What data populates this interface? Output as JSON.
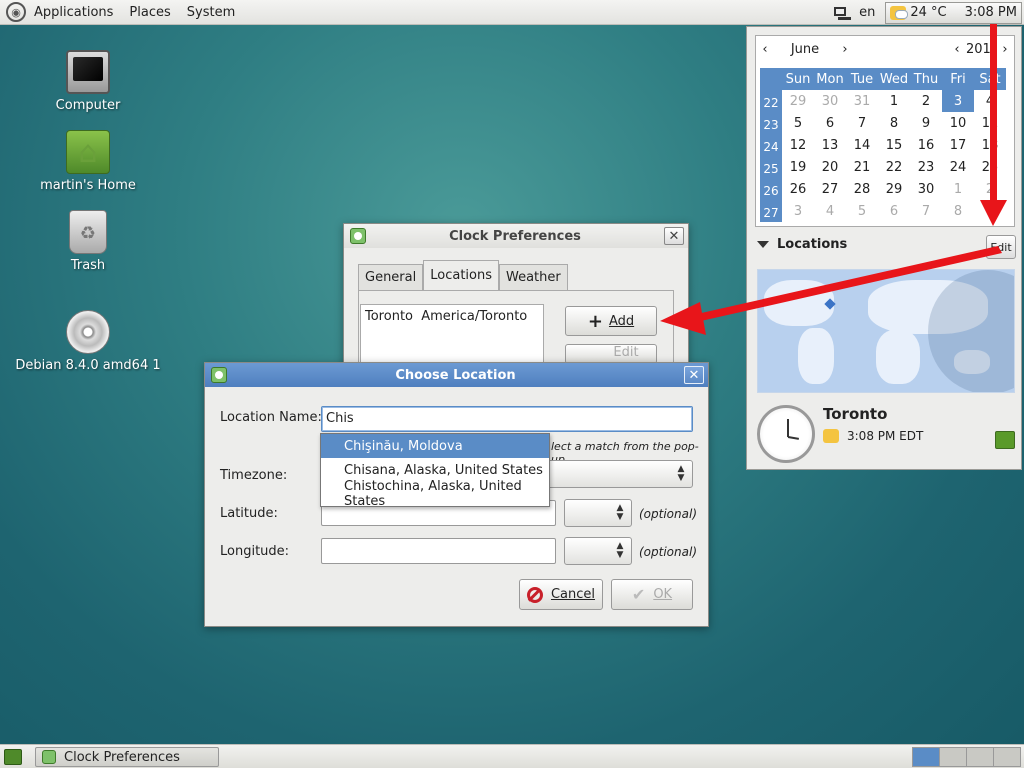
{
  "top_panel": {
    "menus": [
      "Applications",
      "Places",
      "System"
    ],
    "language": "en",
    "temperature": "24 °C",
    "time": "3:08 PM"
  },
  "desktop_icons": [
    {
      "label": "Computer"
    },
    {
      "label": "martin's Home"
    },
    {
      "label": "Trash"
    },
    {
      "label": "Debian 8.4.0 amd64 1"
    }
  ],
  "calendar": {
    "month": "June",
    "year": "2015",
    "day_headers": [
      "Sun",
      "Mon",
      "Tue",
      "Wed",
      "Thu",
      "Fri",
      "Sat"
    ],
    "weeks": [
      {
        "num": "22",
        "days": [
          "29",
          "30",
          "31",
          "1",
          "2",
          "3",
          "4"
        ]
      },
      {
        "num": "23",
        "days": [
          "5",
          "6",
          "7",
          "8",
          "9",
          "10",
          "11"
        ]
      },
      {
        "num": "24",
        "days": [
          "12",
          "13",
          "14",
          "15",
          "16",
          "17",
          "18"
        ]
      },
      {
        "num": "25",
        "days": [
          "19",
          "20",
          "21",
          "22",
          "23",
          "24",
          "25"
        ]
      },
      {
        "num": "26",
        "days": [
          "26",
          "27",
          "28",
          "29",
          "30",
          "1",
          "2"
        ]
      },
      {
        "num": "27",
        "days": [
          "3",
          "4",
          "5",
          "6",
          "7",
          "8",
          "9"
        ]
      }
    ],
    "today": "3",
    "locations_label": "Locations",
    "edit_label": "Edit",
    "city": "Toronto",
    "city_time": "3:08 PM EDT"
  },
  "clock_prefs": {
    "title": "Clock Preferences",
    "tabs": [
      "General",
      "Locations",
      "Weather"
    ],
    "active_tab": "Locations",
    "locations": [
      "Toronto  America/Toronto"
    ],
    "add_label": "Add",
    "edit_label": "Edit"
  },
  "choose_location": {
    "title": "Choose Location",
    "location_name_label": "Location Name:",
    "location_name_value": "Chis",
    "hint": "lect a match from the pop-up.",
    "timezone_label": "Timezone:",
    "latitude_label": "Latitude:",
    "longitude_label": "Longitude:",
    "optional_label": "(optional)",
    "cancel_label": "Cancel",
    "ok_label": "OK",
    "suggestions": [
      "Chişinău, Moldova",
      "Chisana, Alaska, United States",
      "Chistochina, Alaska, United States"
    ]
  },
  "taskbar": {
    "task_label": "Clock Preferences"
  },
  "colors": {
    "accent": "#5a8cc6",
    "annotation_arrow": "#e8151a"
  }
}
